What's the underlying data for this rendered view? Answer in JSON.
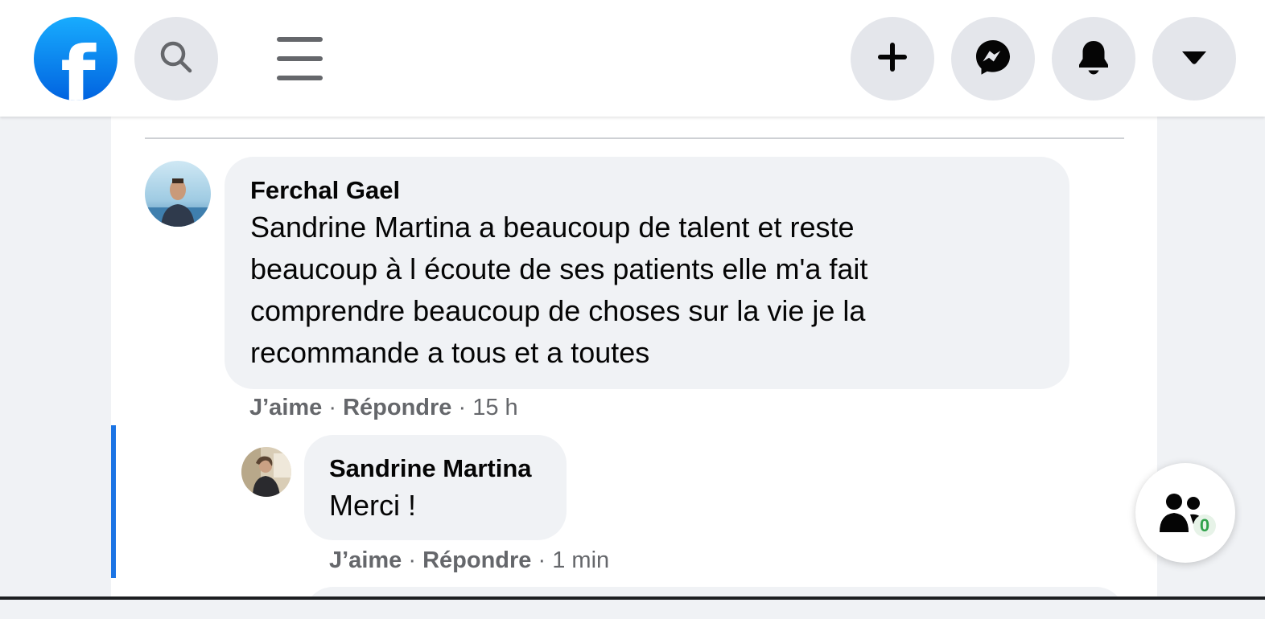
{
  "colors": {
    "accent": "#1b74e4",
    "background": "#f0f2f5",
    "button_bg": "#e4e6eb",
    "muted_text": "#65676b",
    "online_green": "#31a24c"
  },
  "navbar": {
    "logo_icon": "facebook-logo-icon",
    "logo_letter": "f",
    "search_icon": "search-icon",
    "menu_icon": "hamburger-menu-icon",
    "create_icon": "plus-icon",
    "messenger_icon": "messenger-icon",
    "notifications_icon": "bell-icon",
    "account_icon": "caret-down-icon"
  },
  "comments": [
    {
      "author": "Ferchal Gael",
      "text": "Sandrine Martina a beaucoup de talent et reste beaucoup à l écoute de ses patients elle m'a fait comprendre beaucoup de choses sur la vie je la recommande a tous et a toutes",
      "like_label": "J’aime",
      "separator": "·",
      "reply_label": "Répondre",
      "time": "15 h",
      "replies": [
        {
          "author": "Sandrine Martina",
          "text": "Merci !",
          "like_label": "J’aime",
          "separator": "·",
          "reply_label": "Répondre",
          "time": "1 min"
        }
      ]
    }
  ],
  "floating_contacts": {
    "icon": "people-icon",
    "count": "0"
  }
}
